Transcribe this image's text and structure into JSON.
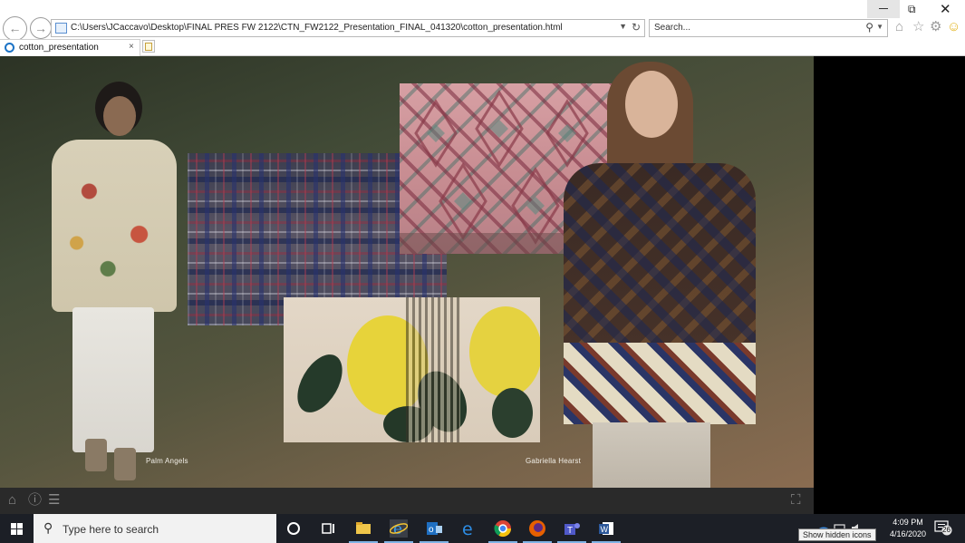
{
  "browser": {
    "url": "C:\\Users\\JCaccavo\\Desktop\\FINAL PRES FW 2122\\CTN_FW2122_Presentation_FINAL_041320\\cotton_presentation.html",
    "search_placeholder": "Search...",
    "tab_title": "cotton_presentation",
    "tab_close": "×"
  },
  "slide": {
    "left_caption": "Palm Angels",
    "right_caption": "Gabriella Hearst"
  },
  "viewer_toolbar": {
    "icons": [
      "home-icon",
      "info-icon",
      "menu-icon",
      "fullscreen-icon"
    ]
  },
  "taskbar": {
    "search_placeholder": "Type here to search",
    "time": "4:09 PM",
    "date": "4/16/2020",
    "notification_count": "26",
    "tooltip": "Show hidden icons"
  },
  "colors": {
    "taskbar_bg": "#1c1f26",
    "viewer_bar_bg": "#2a2a2a",
    "accent": "#1c73c6"
  }
}
